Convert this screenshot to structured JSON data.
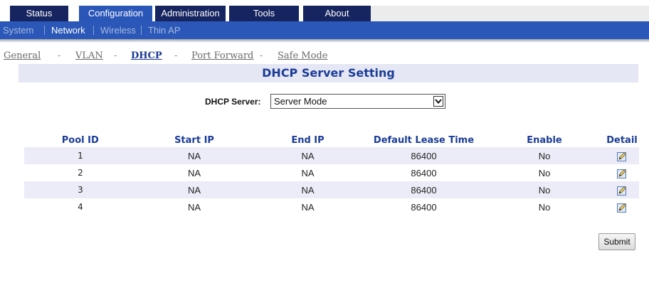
{
  "top_tabs": [
    {
      "label": "Status",
      "active": false
    },
    {
      "label": "Configuration",
      "active": true
    },
    {
      "label": "Administration",
      "active": false
    },
    {
      "label": "Tools",
      "active": false
    },
    {
      "label": "About",
      "active": false
    }
  ],
  "sub_nav": [
    {
      "label": "System",
      "active": false
    },
    {
      "label": "Network",
      "active": true
    },
    {
      "label": "Wireless",
      "active": false
    },
    {
      "label": "Thin AP",
      "active": false
    }
  ],
  "secondary_nav": [
    {
      "label": "General",
      "active": false
    },
    {
      "label": "VLAN",
      "active": false
    },
    {
      "label": "DHCP",
      "active": true
    },
    {
      "label": "Port Forward",
      "active": false
    },
    {
      "label": "Safe Mode",
      "active": false
    }
  ],
  "secondary_nav_separator": "-",
  "section_title": "DHCP Server Setting",
  "dhcp_server": {
    "label": "DHCP Server:",
    "selected": "Server Mode"
  },
  "table": {
    "columns": [
      "Pool ID",
      "Start IP",
      "End IP",
      "Default Lease Time",
      "Enable",
      "Detail"
    ],
    "rows": [
      {
        "pool_id": "1",
        "start_ip": "NA",
        "end_ip": "NA",
        "lease": "86400",
        "enable": "No",
        "detail_icon": "edit-icon"
      },
      {
        "pool_id": "2",
        "start_ip": "NA",
        "end_ip": "NA",
        "lease": "86400",
        "enable": "No",
        "detail_icon": "edit-icon"
      },
      {
        "pool_id": "3",
        "start_ip": "NA",
        "end_ip": "NA",
        "lease": "86400",
        "enable": "No",
        "detail_icon": "edit-icon"
      },
      {
        "pool_id": "4",
        "start_ip": "NA",
        "end_ip": "NA",
        "lease": "86400",
        "enable": "No",
        "detail_icon": "edit-icon"
      }
    ]
  },
  "submit_label": "Submit",
  "colors": {
    "top_tab_bg": "#16245f",
    "top_tab_active_bg": "#2a56b8",
    "sub_nav_bg": "#2b58b8",
    "title_color": "#1b3c97",
    "row_stripe": "#ececf8"
  }
}
